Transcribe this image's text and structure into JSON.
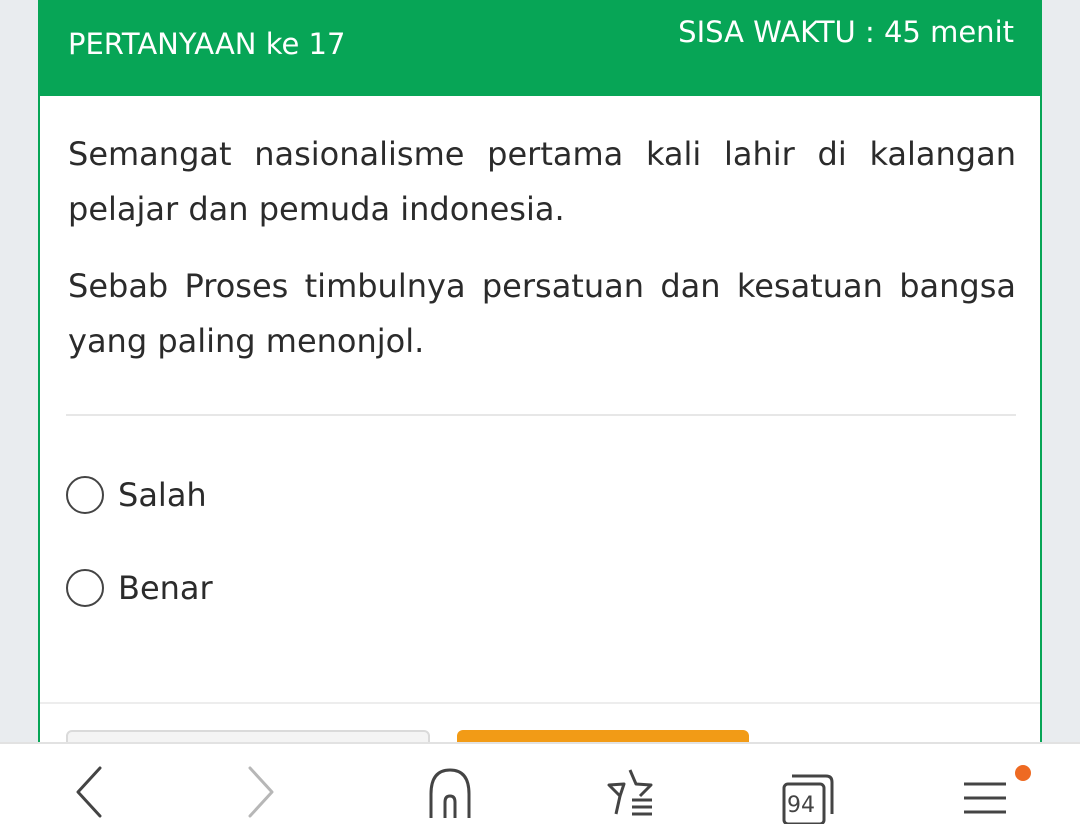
{
  "header": {
    "question_number": "PERTANYAAN ke 17",
    "timer": "SISA WAKTU : 45 menit"
  },
  "question": {
    "paragraphs": [
      "Semangat nasionalisme pertama kali lahir di kalangan pelajar dan pemuda indonesia.",
      "Sebab Proses timbulnya persatuan dan kesatuan bangsa yang paling menonjol."
    ]
  },
  "options": [
    {
      "label": "Salah",
      "selected": false
    },
    {
      "label": "Benar",
      "selected": false
    }
  ],
  "browser_nav": {
    "tab_count": "94",
    "icons": [
      "back-arrow-icon",
      "forward-arrow-icon",
      "home-icon",
      "bookmarks-icon",
      "tabs-icon",
      "menu-icon"
    ],
    "notification_color": "#ee6a22"
  },
  "colors": {
    "accent": "#07a556",
    "next_button": "#f29b16"
  }
}
